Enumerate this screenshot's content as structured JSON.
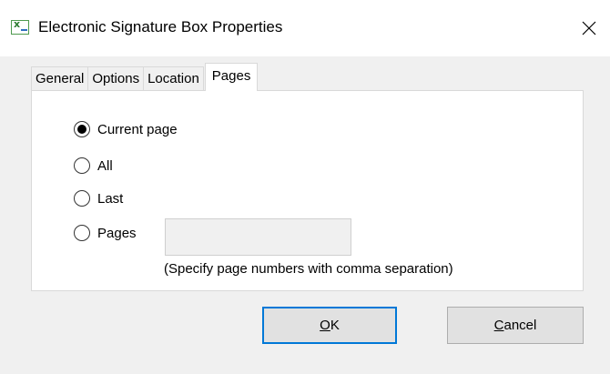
{
  "window": {
    "title": "Electronic Signature Box Properties",
    "icon": "app-icon",
    "close_icon": "close-icon"
  },
  "tabs": [
    {
      "label": "General",
      "active": false
    },
    {
      "label": "Options",
      "active": false
    },
    {
      "label": "Location",
      "active": false
    },
    {
      "label": "Pages",
      "active": true
    }
  ],
  "pages_panel": {
    "options": [
      {
        "label": "Current page",
        "checked": true
      },
      {
        "label": "All",
        "checked": false
      },
      {
        "label": "Last",
        "checked": false
      },
      {
        "label": "Pages",
        "checked": false
      }
    ],
    "pages_input_value": "",
    "hint": "(Specify page numbers with comma separation)"
  },
  "buttons": {
    "ok_mnemonic": "O",
    "ok_rest": "K",
    "cancel_mnemonic": "C",
    "cancel_rest": "ancel"
  },
  "colors": {
    "accent": "#0078d7",
    "dialog_bg": "#f0f0f0",
    "panel_bg": "#ffffff"
  }
}
